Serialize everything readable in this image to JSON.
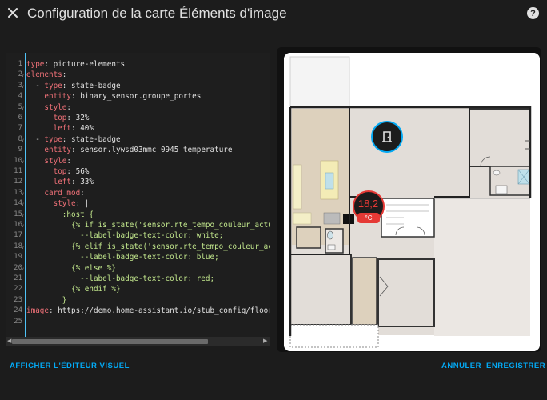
{
  "dialog": {
    "title": "Configuration de la carte Éléments d'image",
    "close_icon": "close-icon",
    "help_icon": "help-icon",
    "help_glyph": "?"
  },
  "editor": {
    "line_numbers": [
      "1",
      "2",
      "3",
      "4",
      "5",
      "6",
      "7",
      "8",
      "9",
      "10",
      "11",
      "12",
      "13",
      "14",
      "15",
      "16",
      "17",
      "18",
      "19",
      "20",
      "21",
      "22",
      "23",
      "24",
      "25"
    ],
    "folded_lines": [
      2,
      3,
      5,
      8,
      10,
      13,
      14,
      15,
      16,
      18,
      20
    ],
    "lines": [
      "type: picture-elements",
      "elements:",
      "  - type: state-badge",
      "    entity: binary_sensor.groupe_portes",
      "    style:",
      "      top: 32%",
      "      left: 40%",
      "  - type: state-badge",
      "    entity: sensor.lywsd03mmc_0945_temperature",
      "    style:",
      "      top: 56%",
      "      left: 33%",
      "    card_mod:",
      "      style: |",
      "        :host {",
      "          {% if is_state('sensor.rte_tempo_couleur_actu",
      "            --label-badge-text-color: white;",
      "          {% elif is_state('sensor.rte_tempo_couleur_ac",
      "            --label-badge-text-color: blue;",
      "          {% else %}",
      "            --label-badge-text-color: red;",
      "          {% endif %}",
      "        }",
      "image: https://demo.home-assistant.io/stub_config/floor",
      ""
    ]
  },
  "preview": {
    "door_badge_icon": "door-icon",
    "temperature_value": "18,2",
    "temperature_unit": "°C",
    "temperature_color": "#e53935",
    "door_badge_color": "#03a9f4"
  },
  "actions": {
    "visual_editor": "AFFICHER L'ÉDITEUR VISUEL",
    "cancel": "ANNULER",
    "save": "ENREGISTRER"
  }
}
